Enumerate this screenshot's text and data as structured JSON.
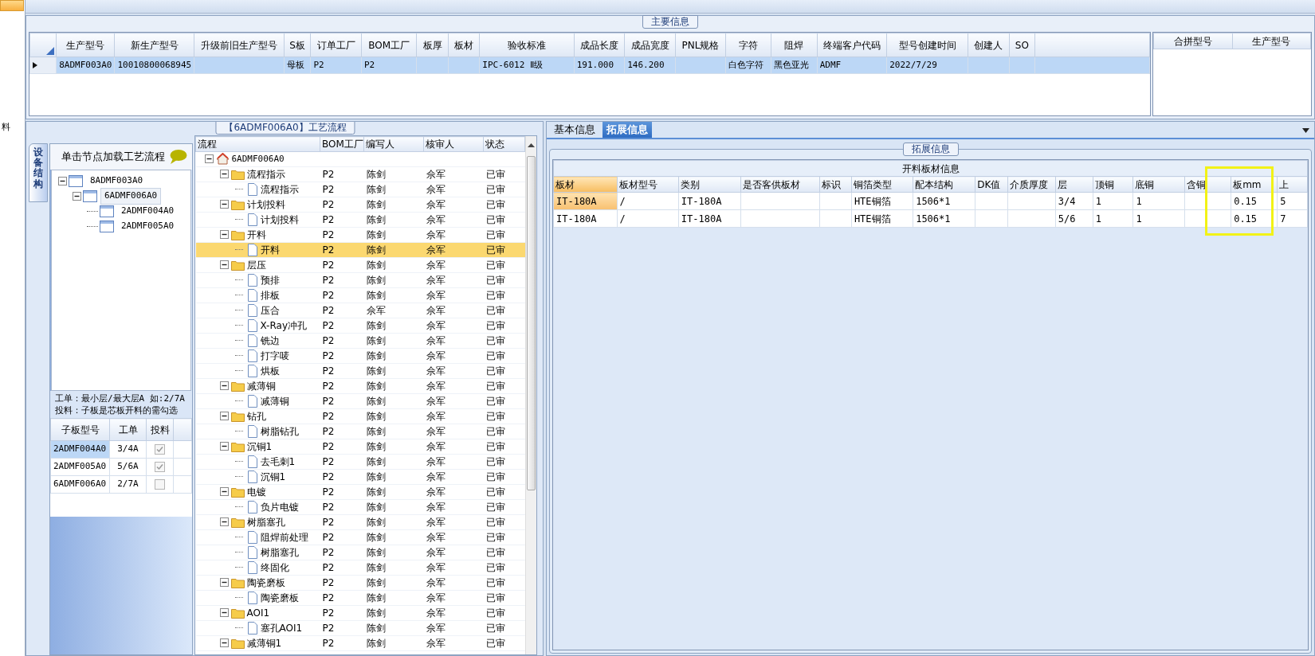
{
  "side_label": "料",
  "main_info": {
    "title": "主要信息",
    "columns": [
      "生产型号",
      "新生产型号",
      "升级前旧生产型号",
      "S板",
      "订单工厂",
      "BOM工厂",
      "板厚",
      "板材",
      "验收标准",
      "成品长度",
      "成品宽度",
      "PNL规格",
      "字符",
      "阻焊",
      "终端客户代码",
      "型号创建时间",
      "创建人",
      "SO"
    ],
    "rows": [
      {
        "selected": true,
        "cells": [
          "8ADMF003A0",
          "10010800068945",
          "",
          "母板",
          "P2",
          "P2",
          "",
          "",
          "IPC-6012 Ⅱ级",
          "191.000",
          "146.200",
          "",
          "白色字符",
          "黑色亚光",
          "ADMF",
          "2022/7/29",
          "",
          ""
        ]
      }
    ]
  },
  "merge_table": {
    "columns": [
      "合拼型号",
      "生产型号"
    ]
  },
  "process_panel": {
    "title": "【6ADMF006A0】工艺流程",
    "vertical_tab": "设备结构",
    "hint": "单击节点加载工艺流程",
    "structure_tree": [
      {
        "label": "8ADMF003A0",
        "selected": false,
        "expanded": true,
        "children": [
          {
            "label": "6ADMF006A0",
            "selected": true,
            "expanded": true,
            "children": [
              {
                "label": "2ADMF004A0",
                "selected": false
              },
              {
                "label": "2ADMF005A0",
                "selected": false
              }
            ]
          }
        ]
      }
    ],
    "notes": [
      "工单：最小层/最大层A 如:2/7A",
      "投料：子板是芯板开料的需勾选"
    ],
    "sub_boards": {
      "columns": [
        "子板型号",
        "工单",
        "投料"
      ],
      "rows": [
        {
          "selected": true,
          "checked": true,
          "cells": [
            "2ADMF004A0",
            "3/4A"
          ]
        },
        {
          "selected": false,
          "checked": true,
          "cells": [
            "2ADMF005A0",
            "5/6A"
          ]
        },
        {
          "selected": false,
          "checked": false,
          "cells": [
            "6ADMF006A0",
            "2/7A"
          ]
        }
      ]
    }
  },
  "flow_grid": {
    "columns": [
      "流程",
      "BOM工厂",
      "编写人",
      "核审人",
      "状态"
    ],
    "nodes": [
      {
        "kind": "root",
        "label": "6ADMF006A0",
        "expanded": true,
        "selected": false,
        "children": [
          {
            "kind": "folder",
            "label": "流程指示",
            "expanded": true,
            "selected": false,
            "cells": [
              "P2",
              "陈剑",
              "佘军",
              "已审"
            ],
            "children": [
              {
                "kind": "step",
                "label": "流程指示",
                "selected": false,
                "cells": [
                  "P2",
                  "陈剑",
                  "佘军",
                  "已审"
                ]
              }
            ]
          },
          {
            "kind": "folder",
            "label": "计划投料",
            "expanded": true,
            "selected": false,
            "cells": [
              "P2",
              "陈剑",
              "佘军",
              "已审"
            ],
            "children": [
              {
                "kind": "step",
                "label": "计划投料",
                "selected": false,
                "cells": [
                  "P2",
                  "陈剑",
                  "佘军",
                  "已审"
                ]
              }
            ]
          },
          {
            "kind": "folder",
            "label": "开料",
            "expanded": true,
            "selected": false,
            "cells": [
              "P2",
              "陈剑",
              "佘军",
              "已审"
            ],
            "children": [
              {
                "kind": "step",
                "label": "开料",
                "selected": true,
                "cells": [
                  "P2",
                  "陈剑",
                  "佘军",
                  "已审"
                ]
              }
            ]
          },
          {
            "kind": "folder",
            "label": "层压",
            "expanded": true,
            "selected": false,
            "cells": [
              "P2",
              "陈剑",
              "佘军",
              "已审"
            ],
            "children": [
              {
                "kind": "step",
                "label": "预排",
                "selected": false,
                "cells": [
                  "P2",
                  "陈剑",
                  "佘军",
                  "已审"
                ]
              },
              {
                "kind": "step",
                "label": "排板",
                "selected": false,
                "cells": [
                  "P2",
                  "陈剑",
                  "佘军",
                  "已审"
                ]
              },
              {
                "kind": "step",
                "label": "压合",
                "selected": false,
                "cells": [
                  "P2",
                  "佘军",
                  "佘军",
                  "已审"
                ]
              },
              {
                "kind": "step",
                "label": "X-Ray冲孔",
                "selected": false,
                "cells": [
                  "P2",
                  "陈剑",
                  "佘军",
                  "已审"
                ]
              },
              {
                "kind": "step",
                "label": "铣边",
                "selected": false,
                "cells": [
                  "P2",
                  "陈剑",
                  "佘军",
                  "已审"
                ]
              },
              {
                "kind": "step",
                "label": "打字唛",
                "selected": false,
                "cells": [
                  "P2",
                  "陈剑",
                  "佘军",
                  "已审"
                ]
              },
              {
                "kind": "step",
                "label": "烘板",
                "selected": false,
                "cells": [
                  "P2",
                  "陈剑",
                  "佘军",
                  "已审"
                ]
              }
            ]
          },
          {
            "kind": "folder",
            "label": "减薄铜",
            "expanded": true,
            "selected": false,
            "cells": [
              "P2",
              "陈剑",
              "佘军",
              "已审"
            ],
            "children": [
              {
                "kind": "step",
                "label": "减薄铜",
                "selected": false,
                "cells": [
                  "P2",
                  "陈剑",
                  "佘军",
                  "已审"
                ]
              }
            ]
          },
          {
            "kind": "folder",
            "label": "钻孔",
            "expanded": true,
            "selected": false,
            "cells": [
              "P2",
              "陈剑",
              "佘军",
              "已审"
            ],
            "children": [
              {
                "kind": "step",
                "label": "树脂钻孔",
                "selected": false,
                "cells": [
                  "P2",
                  "陈剑",
                  "佘军",
                  "已审"
                ]
              }
            ]
          },
          {
            "kind": "folder",
            "label": "沉铜1",
            "expanded": true,
            "selected": false,
            "cells": [
              "P2",
              "陈剑",
              "佘军",
              "已审"
            ],
            "children": [
              {
                "kind": "step",
                "label": "去毛刺1",
                "selected": false,
                "cells": [
                  "P2",
                  "陈剑",
                  "佘军",
                  "已审"
                ]
              },
              {
                "kind": "step",
                "label": "沉铜1",
                "selected": false,
                "cells": [
                  "P2",
                  "陈剑",
                  "佘军",
                  "已审"
                ]
              }
            ]
          },
          {
            "kind": "folder",
            "label": "电镀",
            "expanded": true,
            "selected": false,
            "cells": [
              "P2",
              "陈剑",
              "佘军",
              "已审"
            ],
            "children": [
              {
                "kind": "step",
                "label": "负片电镀",
                "selected": false,
                "cells": [
                  "P2",
                  "陈剑",
                  "佘军",
                  "已审"
                ]
              }
            ]
          },
          {
            "kind": "folder",
            "label": "树脂塞孔",
            "expanded": true,
            "selected": false,
            "cells": [
              "P2",
              "陈剑",
              "佘军",
              "已审"
            ],
            "children": [
              {
                "kind": "step",
                "label": "阻焊前处理",
                "selected": false,
                "cells": [
                  "P2",
                  "陈剑",
                  "佘军",
                  "已审"
                ]
              },
              {
                "kind": "step",
                "label": "树脂塞孔",
                "selected": false,
                "cells": [
                  "P2",
                  "陈剑",
                  "佘军",
                  "已审"
                ]
              },
              {
                "kind": "step",
                "label": "终固化",
                "selected": false,
                "cells": [
                  "P2",
                  "陈剑",
                  "佘军",
                  "已审"
                ]
              }
            ]
          },
          {
            "kind": "folder",
            "label": "陶瓷磨板",
            "expanded": true,
            "selected": false,
            "cells": [
              "P2",
              "陈剑",
              "佘军",
              "已审"
            ],
            "children": [
              {
                "kind": "step",
                "label": "陶瓷磨板",
                "selected": false,
                "cells": [
                  "P2",
                  "陈剑",
                  "佘军",
                  "已审"
                ]
              }
            ]
          },
          {
            "kind": "folder",
            "label": "AOI1",
            "expanded": true,
            "selected": false,
            "cells": [
              "P2",
              "陈剑",
              "佘军",
              "已审"
            ],
            "children": [
              {
                "kind": "step",
                "label": "塞孔AOI1",
                "selected": false,
                "cells": [
                  "P2",
                  "陈剑",
                  "佘军",
                  "已审"
                ]
              }
            ]
          },
          {
            "kind": "folder",
            "label": "减薄铜1",
            "expanded": true,
            "selected": false,
            "cells": [
              "P2",
              "陈剑",
              "佘军",
              "已审"
            ]
          }
        ]
      }
    ]
  },
  "detail_panel": {
    "tabs": [
      {
        "label": "基本信息",
        "selected": false
      },
      {
        "label": "拓展信息",
        "selected": true
      }
    ],
    "group_title": "拓展信息",
    "table": {
      "title": "开料板材信息",
      "columns": [
        {
          "label": "板材",
          "selected": true,
          "highlighted": false
        },
        {
          "label": "板材型号",
          "selected": false,
          "highlighted": false
        },
        {
          "label": "类别",
          "selected": false,
          "highlighted": false
        },
        {
          "label": "是否客供板材",
          "selected": false,
          "highlighted": false
        },
        {
          "label": "标识",
          "selected": false,
          "highlighted": false
        },
        {
          "label": "铜箔类型",
          "selected": false,
          "highlighted": false
        },
        {
          "label": "配本结构",
          "selected": false,
          "highlighted": false
        },
        {
          "label": "DK值",
          "selected": false,
          "highlighted": false
        },
        {
          "label": "介质厚度",
          "selected": false,
          "highlighted": false
        },
        {
          "label": "层",
          "selected": false,
          "highlighted": false
        },
        {
          "label": "顶铜",
          "selected": false,
          "highlighted": false
        },
        {
          "label": "底铜",
          "selected": false,
          "highlighted": false
        },
        {
          "label": "含铜",
          "selected": false,
          "highlighted": false
        },
        {
          "label": "板mm",
          "selected": false,
          "highlighted": true
        },
        {
          "label": "上",
          "selected": false,
          "highlighted": false
        }
      ],
      "rows": [
        {
          "selected": true,
          "cells": [
            "IT-180A",
            "/",
            "IT-180A",
            "",
            "",
            "HTE铜箔",
            "1506*1",
            "",
            "",
            "3/4",
            "1",
            "1",
            "",
            "0.15",
            "5"
          ]
        },
        {
          "selected": false,
          "cells": [
            "IT-180A",
            "/",
            "IT-180A",
            "",
            "",
            "HTE铜箔",
            "1506*1",
            "",
            "",
            "5/6",
            "1",
            "1",
            "",
            "0.15",
            "7"
          ]
        }
      ]
    }
  }
}
